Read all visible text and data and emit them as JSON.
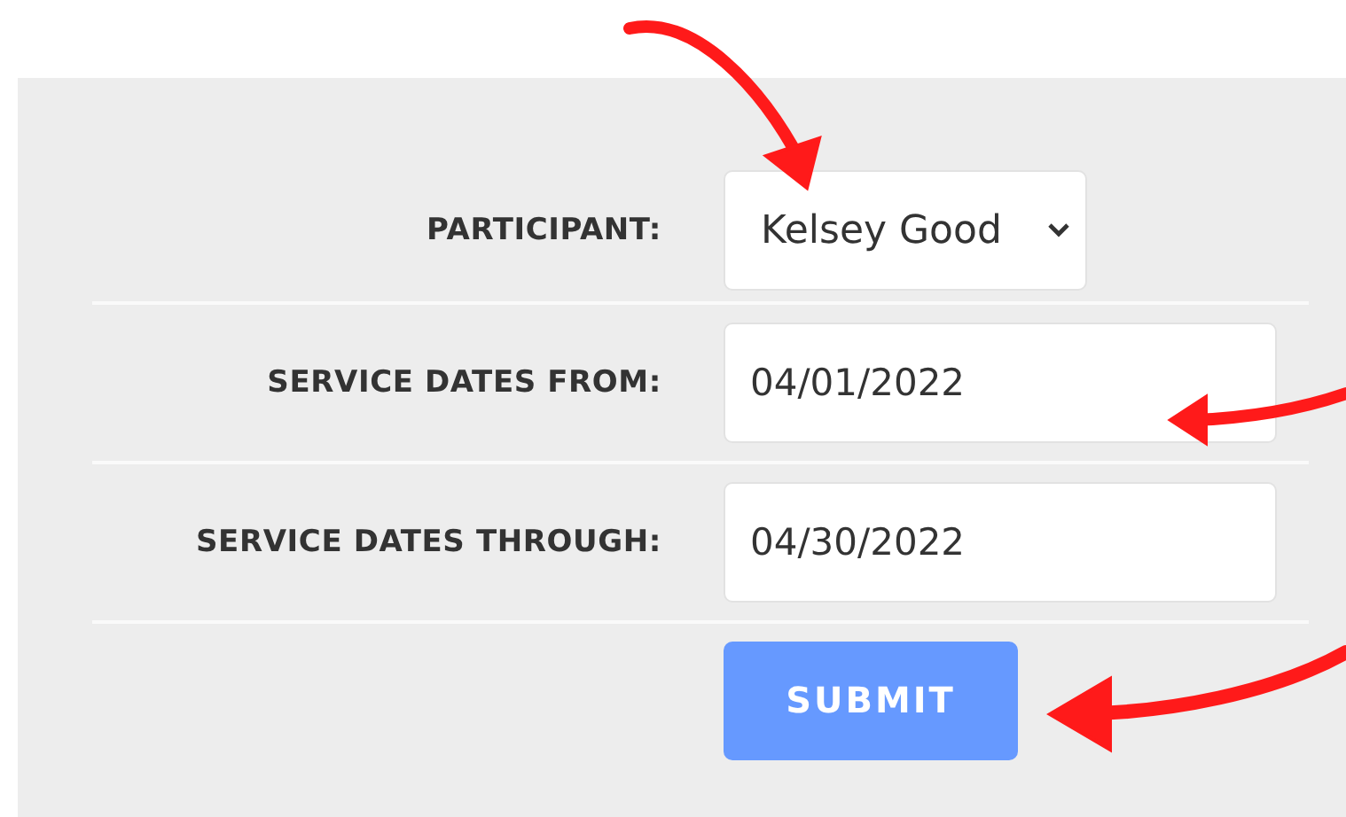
{
  "form": {
    "fields": [
      {
        "kind": "select",
        "label": "PARTICIPANT:",
        "value": "Kelsey Good"
      },
      {
        "kind": "text",
        "label": "SERVICE DATES FROM:",
        "value": "04/01/2022"
      },
      {
        "kind": "text",
        "label": "SERVICE DATES THROUGH:",
        "value": "04/30/2022"
      }
    ],
    "submit": "SUBMIT"
  }
}
